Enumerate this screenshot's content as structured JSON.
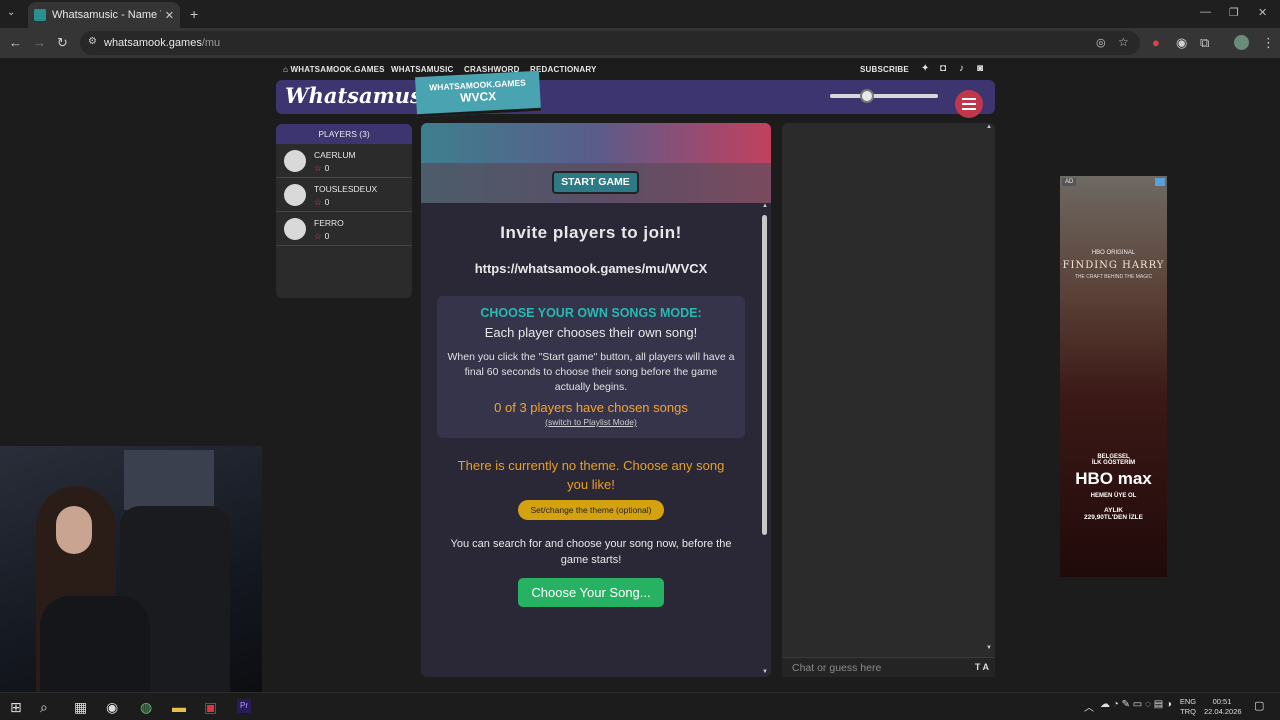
{
  "browser": {
    "tab_title": "Whatsamusic - Name That Tune",
    "new_tab": "+",
    "url_host": "whatsamook.games",
    "url_path": "/mu"
  },
  "site": {
    "nav": {
      "home": "WHATSAMOOK.GAMES",
      "whatsamusic": "WHATSAMUSIC",
      "crashword": "CRASHWORD",
      "redactionary": "REDACTIONARY",
      "subscribe": "SUBSCRIBE"
    },
    "logo": "Whatsamusic",
    "room": {
      "site": "WHATSAMOOK.GAMES",
      "code": "WVCX"
    },
    "volume_percent": 32
  },
  "players": {
    "header": "PLAYERS (3)",
    "list": [
      {
        "name": "CAERLUM",
        "score": "0"
      },
      {
        "name": "TOUSLESDEUX",
        "score": "0"
      },
      {
        "name": "FERRO",
        "score": "0"
      }
    ]
  },
  "game": {
    "start_button": "START GAME",
    "invite_heading": "Invite players to join!",
    "invite_url": "https://whatsamook.games/mu/WVCX",
    "mode_title": "CHOOSE YOUR OWN SONGS MODE:",
    "mode_subtitle": "Each player chooses their own song!",
    "mode_description": "When you click the \"Start game\" button, all players will have a final 60 seconds to choose their song before the game actually begins.",
    "chosen_status": "0 of 3 players have chosen songs",
    "switch_link": "(switch to Playlist Mode)",
    "theme_text": "There is currently no theme. Choose any song you like!",
    "theme_button": "Set/change the theme (optional)",
    "search_text": "You can search for and choose your song now, before the game starts!",
    "choose_button": "Choose Your Song..."
  },
  "chat": {
    "placeholder": "Chat or guess here",
    "ta_label": "T A"
  },
  "ad": {
    "tag": "AD",
    "brand_top": "HBO ORIGINAL",
    "title": "FINDING HARRY",
    "tagline": "THE CRAFT BEHIND THE MAGIC",
    "line1": "BELGESEL",
    "line2": "İLK GÖSTERİM",
    "logo": "HBO max",
    "cta": "HEMEN ÜYE OL",
    "price1": "AYLIK",
    "price2": "229,90TL'DEN İZLE"
  },
  "taskbar": {
    "lang1": "ENG",
    "lang2": "TRQ",
    "time": "00:51",
    "date": "22.04.2026"
  }
}
